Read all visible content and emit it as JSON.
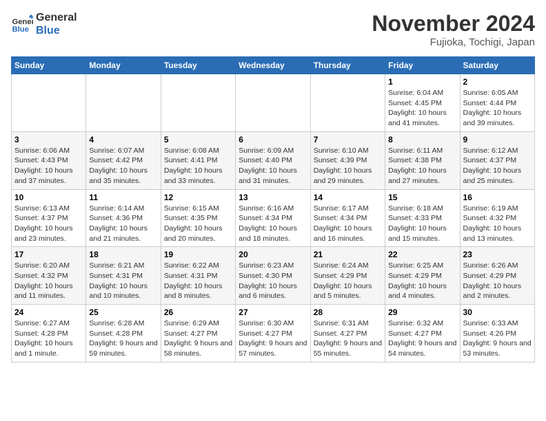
{
  "logo": {
    "line1": "General",
    "line2": "Blue"
  },
  "title": "November 2024",
  "location": "Fujioka, Tochigi, Japan",
  "weekdays": [
    "Sunday",
    "Monday",
    "Tuesday",
    "Wednesday",
    "Thursday",
    "Friday",
    "Saturday"
  ],
  "weeks": [
    [
      {
        "day": "",
        "info": ""
      },
      {
        "day": "",
        "info": ""
      },
      {
        "day": "",
        "info": ""
      },
      {
        "day": "",
        "info": ""
      },
      {
        "day": "",
        "info": ""
      },
      {
        "day": "1",
        "info": "Sunrise: 6:04 AM\nSunset: 4:45 PM\nDaylight: 10 hours and 41 minutes."
      },
      {
        "day": "2",
        "info": "Sunrise: 6:05 AM\nSunset: 4:44 PM\nDaylight: 10 hours and 39 minutes."
      }
    ],
    [
      {
        "day": "3",
        "info": "Sunrise: 6:06 AM\nSunset: 4:43 PM\nDaylight: 10 hours and 37 minutes."
      },
      {
        "day": "4",
        "info": "Sunrise: 6:07 AM\nSunset: 4:42 PM\nDaylight: 10 hours and 35 minutes."
      },
      {
        "day": "5",
        "info": "Sunrise: 6:08 AM\nSunset: 4:41 PM\nDaylight: 10 hours and 33 minutes."
      },
      {
        "day": "6",
        "info": "Sunrise: 6:09 AM\nSunset: 4:40 PM\nDaylight: 10 hours and 31 minutes."
      },
      {
        "day": "7",
        "info": "Sunrise: 6:10 AM\nSunset: 4:39 PM\nDaylight: 10 hours and 29 minutes."
      },
      {
        "day": "8",
        "info": "Sunrise: 6:11 AM\nSunset: 4:38 PM\nDaylight: 10 hours and 27 minutes."
      },
      {
        "day": "9",
        "info": "Sunrise: 6:12 AM\nSunset: 4:37 PM\nDaylight: 10 hours and 25 minutes."
      }
    ],
    [
      {
        "day": "10",
        "info": "Sunrise: 6:13 AM\nSunset: 4:37 PM\nDaylight: 10 hours and 23 minutes."
      },
      {
        "day": "11",
        "info": "Sunrise: 6:14 AM\nSunset: 4:36 PM\nDaylight: 10 hours and 21 minutes."
      },
      {
        "day": "12",
        "info": "Sunrise: 6:15 AM\nSunset: 4:35 PM\nDaylight: 10 hours and 20 minutes."
      },
      {
        "day": "13",
        "info": "Sunrise: 6:16 AM\nSunset: 4:34 PM\nDaylight: 10 hours and 18 minutes."
      },
      {
        "day": "14",
        "info": "Sunrise: 6:17 AM\nSunset: 4:34 PM\nDaylight: 10 hours and 16 minutes."
      },
      {
        "day": "15",
        "info": "Sunrise: 6:18 AM\nSunset: 4:33 PM\nDaylight: 10 hours and 15 minutes."
      },
      {
        "day": "16",
        "info": "Sunrise: 6:19 AM\nSunset: 4:32 PM\nDaylight: 10 hours and 13 minutes."
      }
    ],
    [
      {
        "day": "17",
        "info": "Sunrise: 6:20 AM\nSunset: 4:32 PM\nDaylight: 10 hours and 11 minutes."
      },
      {
        "day": "18",
        "info": "Sunrise: 6:21 AM\nSunset: 4:31 PM\nDaylight: 10 hours and 10 minutes."
      },
      {
        "day": "19",
        "info": "Sunrise: 6:22 AM\nSunset: 4:31 PM\nDaylight: 10 hours and 8 minutes."
      },
      {
        "day": "20",
        "info": "Sunrise: 6:23 AM\nSunset: 4:30 PM\nDaylight: 10 hours and 6 minutes."
      },
      {
        "day": "21",
        "info": "Sunrise: 6:24 AM\nSunset: 4:29 PM\nDaylight: 10 hours and 5 minutes."
      },
      {
        "day": "22",
        "info": "Sunrise: 6:25 AM\nSunset: 4:29 PM\nDaylight: 10 hours and 4 minutes."
      },
      {
        "day": "23",
        "info": "Sunrise: 6:26 AM\nSunset: 4:29 PM\nDaylight: 10 hours and 2 minutes."
      }
    ],
    [
      {
        "day": "24",
        "info": "Sunrise: 6:27 AM\nSunset: 4:28 PM\nDaylight: 10 hours and 1 minute."
      },
      {
        "day": "25",
        "info": "Sunrise: 6:28 AM\nSunset: 4:28 PM\nDaylight: 9 hours and 59 minutes."
      },
      {
        "day": "26",
        "info": "Sunrise: 6:29 AM\nSunset: 4:27 PM\nDaylight: 9 hours and 58 minutes."
      },
      {
        "day": "27",
        "info": "Sunrise: 6:30 AM\nSunset: 4:27 PM\nDaylight: 9 hours and 57 minutes."
      },
      {
        "day": "28",
        "info": "Sunrise: 6:31 AM\nSunset: 4:27 PM\nDaylight: 9 hours and 55 minutes."
      },
      {
        "day": "29",
        "info": "Sunrise: 6:32 AM\nSunset: 4:27 PM\nDaylight: 9 hours and 54 minutes."
      },
      {
        "day": "30",
        "info": "Sunrise: 6:33 AM\nSunset: 4:26 PM\nDaylight: 9 hours and 53 minutes."
      }
    ]
  ]
}
